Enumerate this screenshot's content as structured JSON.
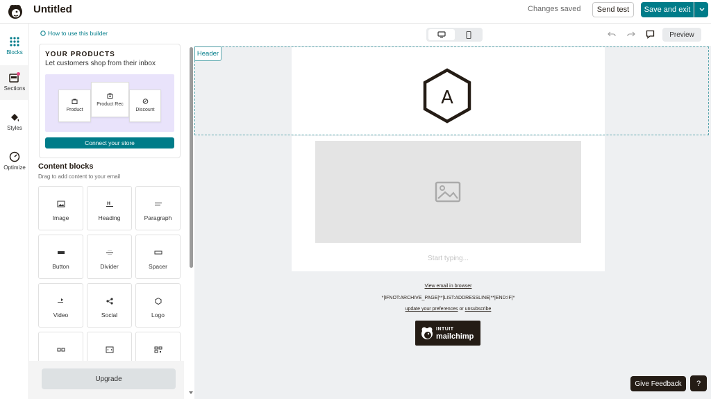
{
  "app": {
    "title": "Untitled",
    "status": "Changes saved",
    "send_test_label": "Send test",
    "save_exit_label": "Save and exit",
    "brand_color": "#007c89"
  },
  "rail": {
    "items": [
      {
        "label": "Blocks",
        "icon": "grid-dots-icon",
        "active": true
      },
      {
        "label": "Sections",
        "icon": "sections-icon",
        "badge": true
      },
      {
        "label": "Styles",
        "icon": "paint-bucket-icon"
      },
      {
        "label": "Optimize",
        "icon": "gauge-icon"
      }
    ]
  },
  "panel": {
    "howto_label": "How to use this builder",
    "products": {
      "title": "YOUR PRODUCTS",
      "subtitle": "Let customers shop from their inbox",
      "cards": [
        "Product",
        "Product Rec",
        "Discount"
      ],
      "connect_label": "Connect your store"
    },
    "content_blocks": {
      "title": "Content blocks",
      "subtitle": "Drag to add content to your email",
      "blocks": [
        {
          "label": "Image",
          "icon": "image-icon"
        },
        {
          "label": "Heading",
          "icon": "heading-icon"
        },
        {
          "label": "Paragraph",
          "icon": "paragraph-icon"
        },
        {
          "label": "Button",
          "icon": "button-icon"
        },
        {
          "label": "Divider",
          "icon": "divider-icon"
        },
        {
          "label": "Spacer",
          "icon": "spacer-icon"
        },
        {
          "label": "Video",
          "icon": "video-icon"
        },
        {
          "label": "Social",
          "icon": "social-icon"
        },
        {
          "label": "Logo",
          "icon": "logo-icon"
        },
        {
          "label": "",
          "icon": "product-icon"
        },
        {
          "label": "",
          "icon": "code-icon"
        },
        {
          "label": "",
          "icon": "qr-icon"
        }
      ]
    },
    "upgrade_label": "Upgrade"
  },
  "canvas": {
    "preview_label": "Preview",
    "header_tag": "Header",
    "logo_letter": "A",
    "start_typing": "Start typing...",
    "footer": {
      "view_in_browser": "View email in browser",
      "merge_line": "*|IFNOT:ARCHIVE_PAGE|**|LIST:ADDRESSLINE|**|END:IF|*",
      "update_prefs": "update your preferences",
      "or_text": " or ",
      "unsubscribe": "unsubscribe",
      "badge_line1": "INTUIT",
      "badge_line2": "mailchimp"
    }
  },
  "feedback": {
    "give_feedback_label": "Give Feedback",
    "help_label": "?"
  }
}
